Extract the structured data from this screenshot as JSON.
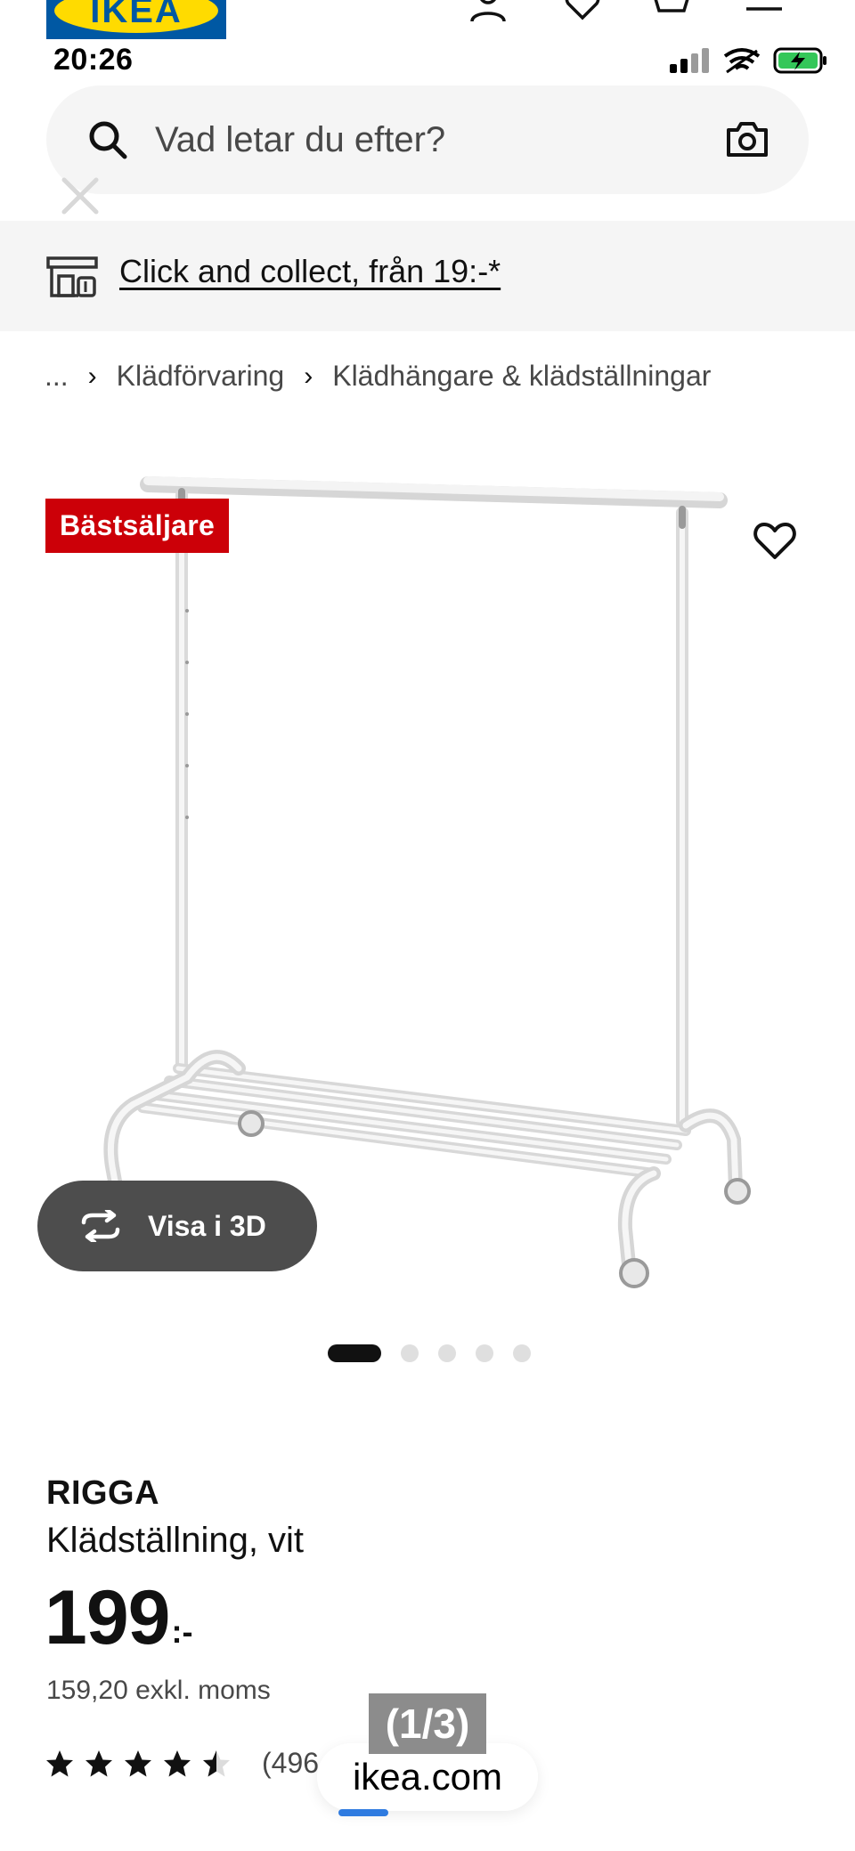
{
  "header": {
    "logo_text": "IKEA"
  },
  "status_bar": {
    "time": "20:26"
  },
  "search": {
    "placeholder": "Vad letar du efter?"
  },
  "banner": {
    "click_collect_label": "Click and collect, från 19:-*"
  },
  "breadcrumb": {
    "items": [
      "...",
      "Klädförvaring",
      "Klädhängare & klädställningar"
    ]
  },
  "product": {
    "badge": "Bästsäljare",
    "view_3d_label": "Visa i 3D",
    "carousel": {
      "total": 5,
      "active": 1
    },
    "name": "RIGGA",
    "description": "Klädställning, vit",
    "price_main": "199",
    "price_suffix": ":-",
    "price_excl_vat": "159,20 exkl. moms",
    "rating": 4.5,
    "review_count": "(496"
  },
  "browser": {
    "url": "ikea.com",
    "page_counter": "(1/3)"
  },
  "colors": {
    "badge_red": "#cc0008",
    "ikea_blue": "#0058a3",
    "ikea_yellow": "#ffdb00",
    "surface_gray": "#f5f5f5"
  }
}
